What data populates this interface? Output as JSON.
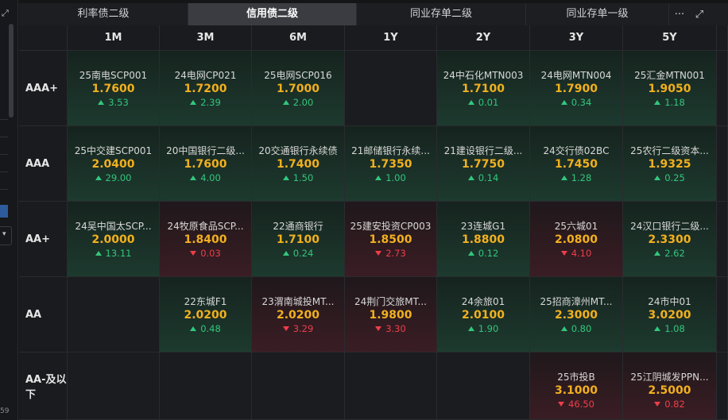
{
  "tabs": [
    "利率债二级",
    "信用债二级",
    "同业存单二级",
    "同业存单一级"
  ],
  "active_tab": 1,
  "left_panel_number": "59",
  "columns": [
    "1M",
    "3M",
    "6M",
    "1Y",
    "2Y",
    "3Y",
    "5Y"
  ],
  "rows": [
    {
      "label": "AAA+",
      "cells": [
        {
          "name": "25南电SCP001",
          "value": "1.7600",
          "change": "3.53",
          "dir": "up"
        },
        {
          "name": "24电网CP021",
          "value": "1.7200",
          "change": "2.39",
          "dir": "up"
        },
        {
          "name": "25电网SCP016",
          "value": "1.7000",
          "change": "2.00",
          "dir": "up"
        },
        null,
        {
          "name": "24中石化MTN003",
          "value": "1.7100",
          "change": "0.01",
          "dir": "up"
        },
        {
          "name": "24电网MTN004",
          "value": "1.7900",
          "change": "0.34",
          "dir": "up"
        },
        {
          "name": "25汇金MTN001",
          "value": "1.9050",
          "change": "1.18",
          "dir": "up"
        }
      ]
    },
    {
      "label": "AAA",
      "cells": [
        {
          "name": "25中交建SCP001",
          "value": "2.0400",
          "change": "29.00",
          "dir": "up"
        },
        {
          "name": "20中国银行二级...",
          "value": "1.7600",
          "change": "4.00",
          "dir": "up"
        },
        {
          "name": "20交通银行永续债",
          "value": "1.7400",
          "change": "1.50",
          "dir": "up"
        },
        {
          "name": "21邮储银行永续...",
          "value": "1.7350",
          "change": "1.00",
          "dir": "up"
        },
        {
          "name": "21建设银行二级...",
          "value": "1.7750",
          "change": "0.14",
          "dir": "up"
        },
        {
          "name": "24交行债02BC",
          "value": "1.7450",
          "change": "1.28",
          "dir": "up"
        },
        {
          "name": "25农行二级资本...",
          "value": "1.9325",
          "change": "0.25",
          "dir": "up"
        }
      ]
    },
    {
      "label": "AA+",
      "cells": [
        {
          "name": "24吴中国太SCP...",
          "value": "2.0000",
          "change": "13.11",
          "dir": "up"
        },
        {
          "name": "24牧原食品SCP...",
          "value": "1.8400",
          "change": "0.03",
          "dir": "down"
        },
        {
          "name": "22通商银行",
          "value": "1.7100",
          "change": "0.24",
          "dir": "up"
        },
        {
          "name": "25建安投资CP003",
          "value": "1.8500",
          "change": "2.73",
          "dir": "down"
        },
        {
          "name": "23连城G1",
          "value": "1.8800",
          "change": "0.12",
          "dir": "up"
        },
        {
          "name": "25六城01",
          "value": "2.0800",
          "change": "4.10",
          "dir": "down"
        },
        {
          "name": "24汉口银行二级...",
          "value": "2.3300",
          "change": "2.62",
          "dir": "up"
        }
      ]
    },
    {
      "label": "AA",
      "cells": [
        null,
        {
          "name": "22东城F1",
          "value": "2.0200",
          "change": "0.48",
          "dir": "up"
        },
        {
          "name": "23渭南城投MT...",
          "value": "2.0200",
          "change": "3.29",
          "dir": "down"
        },
        {
          "name": "24荆门交旅MT...",
          "value": "1.9800",
          "change": "3.30",
          "dir": "down"
        },
        {
          "name": "24余旅01",
          "value": "2.0100",
          "change": "1.90",
          "dir": "up"
        },
        {
          "name": "25招商漳州MT...",
          "value": "2.3000",
          "change": "0.80",
          "dir": "up"
        },
        {
          "name": "24市中01",
          "value": "3.0200",
          "change": "1.08",
          "dir": "up"
        }
      ]
    },
    {
      "label": "AA-及以下",
      "cells": [
        null,
        null,
        null,
        null,
        null,
        {
          "name": "25市投B",
          "value": "3.1000",
          "change": "46.50",
          "dir": "down"
        },
        {
          "name": "25江阴城发PPN...",
          "value": "2.5000",
          "change": "0.82",
          "dir": "down"
        }
      ]
    }
  ]
}
